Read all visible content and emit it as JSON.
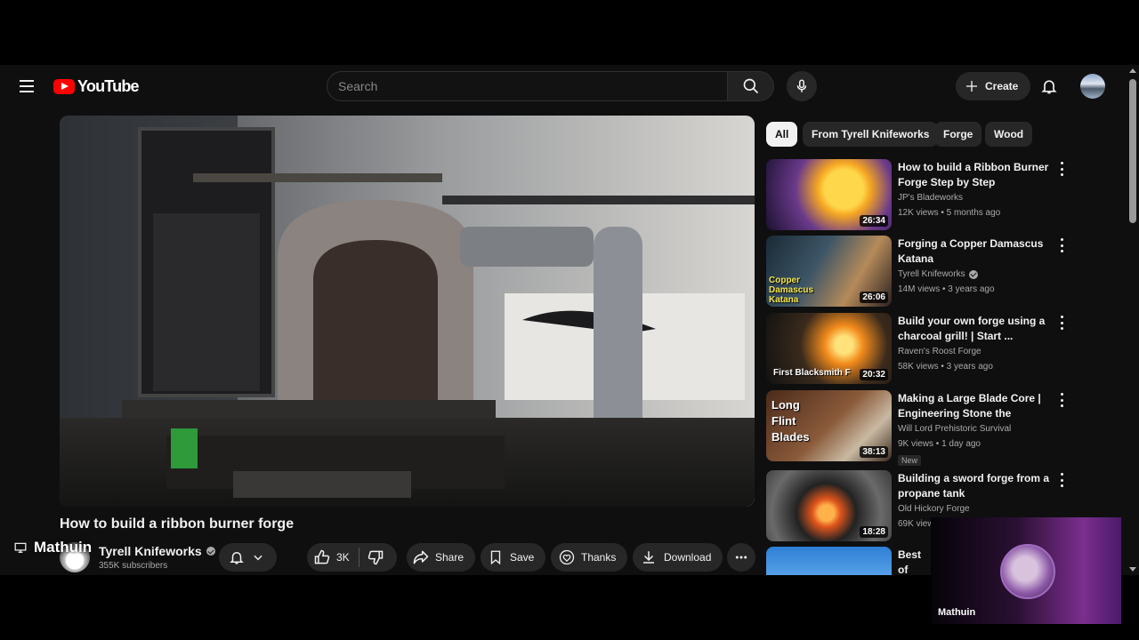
{
  "header": {
    "logo_text": "YouTube",
    "search_placeholder": "Search",
    "create_label": "Create"
  },
  "video": {
    "title": "How to build a ribbon burner forge",
    "channel": "Tyrell Knifeworks",
    "subscribers": "355K subscribers",
    "likes": "3K",
    "share_label": "Share",
    "save_label": "Save",
    "thanks_label": "Thanks",
    "download_label": "Download"
  },
  "chips": [
    "All",
    "From Tyrell Knifeworks",
    "Forge",
    "Wood"
  ],
  "recommendations": [
    {
      "title": "How to build a Ribbon Burner Forge Step by Step",
      "channel": "JP's Bladeworks",
      "meta": "12K views • 5 months ago",
      "duration": "26:34"
    },
    {
      "title": "Forging a Copper Damascus Katana",
      "channel": "Tyrell Knifeworks",
      "meta": "14M views • 3 years ago",
      "duration": "26:06",
      "thumb_text": "Copper Damascus Katana"
    },
    {
      "title": "Build your own forge using a charcoal grill! | Start ...",
      "channel": "Raven's Roost Forge",
      "meta": "58K views • 3 years ago",
      "duration": "20:32",
      "thumb_text": "First Blacksmith F"
    },
    {
      "title": "Making a Large Blade Core | Engineering Stone the Ancient ...",
      "channel": "Will Lord Prehistoric Survival",
      "meta": "9K views • 1 day ago",
      "duration": "38:13",
      "badge": "New",
      "thumb_text": "Long Flint Blades"
    },
    {
      "title": "Building a sword forge from a propane tank",
      "channel": "Old Hickory Forge",
      "meta": "69K view",
      "duration": "18:28"
    },
    {
      "title": "Best of Marath",
      "channel": "",
      "meta": "",
      "duration": ""
    }
  ],
  "overlay": {
    "stream_name": "Mathuin",
    "cam_name": "Mathuin"
  },
  "colors": {
    "background": "#0f0f0f",
    "pill": "#272727",
    "brand_red": "#ff0000"
  }
}
